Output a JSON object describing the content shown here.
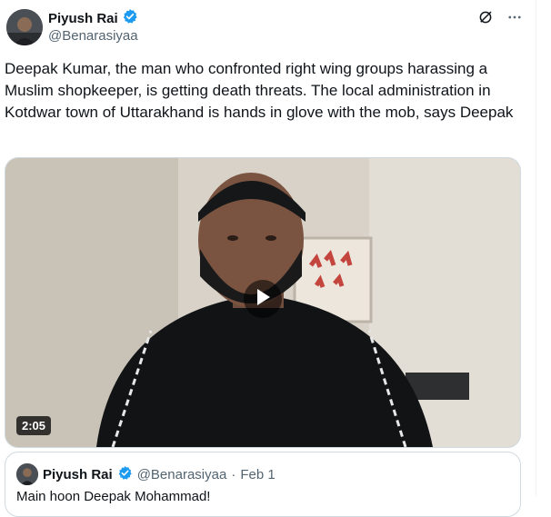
{
  "author": {
    "name": "Piyush Rai",
    "handle": "@Benarasiyaa",
    "avatar_icon": "profile-photo",
    "verified_icon": "verified-badge-icon",
    "verified_color": "#1d9bf0"
  },
  "header_icons": [
    "grok-slash-icon",
    "more-icon"
  ],
  "tweet": {
    "text": "Deepak Kumar, the man who confronted right wing groups harassing a Muslim shopkeeper, is getting death threats. The local administration in Kotdwar town of Uttarakhand is hands in glove with the mob, says Deepak"
  },
  "video": {
    "duration": "2:05",
    "play_icon": "play-icon"
  },
  "quoted_tweet": {
    "name": "Piyush Rai",
    "handle": "@Benarasiyaa",
    "separator": "·",
    "date": "Feb 1",
    "text": "Main hoon Deepak Mohammad!"
  },
  "colors": {
    "text": "#0f1419",
    "secondary": "#536471",
    "border": "#cfd9de",
    "accent": "#1d9bf0"
  }
}
